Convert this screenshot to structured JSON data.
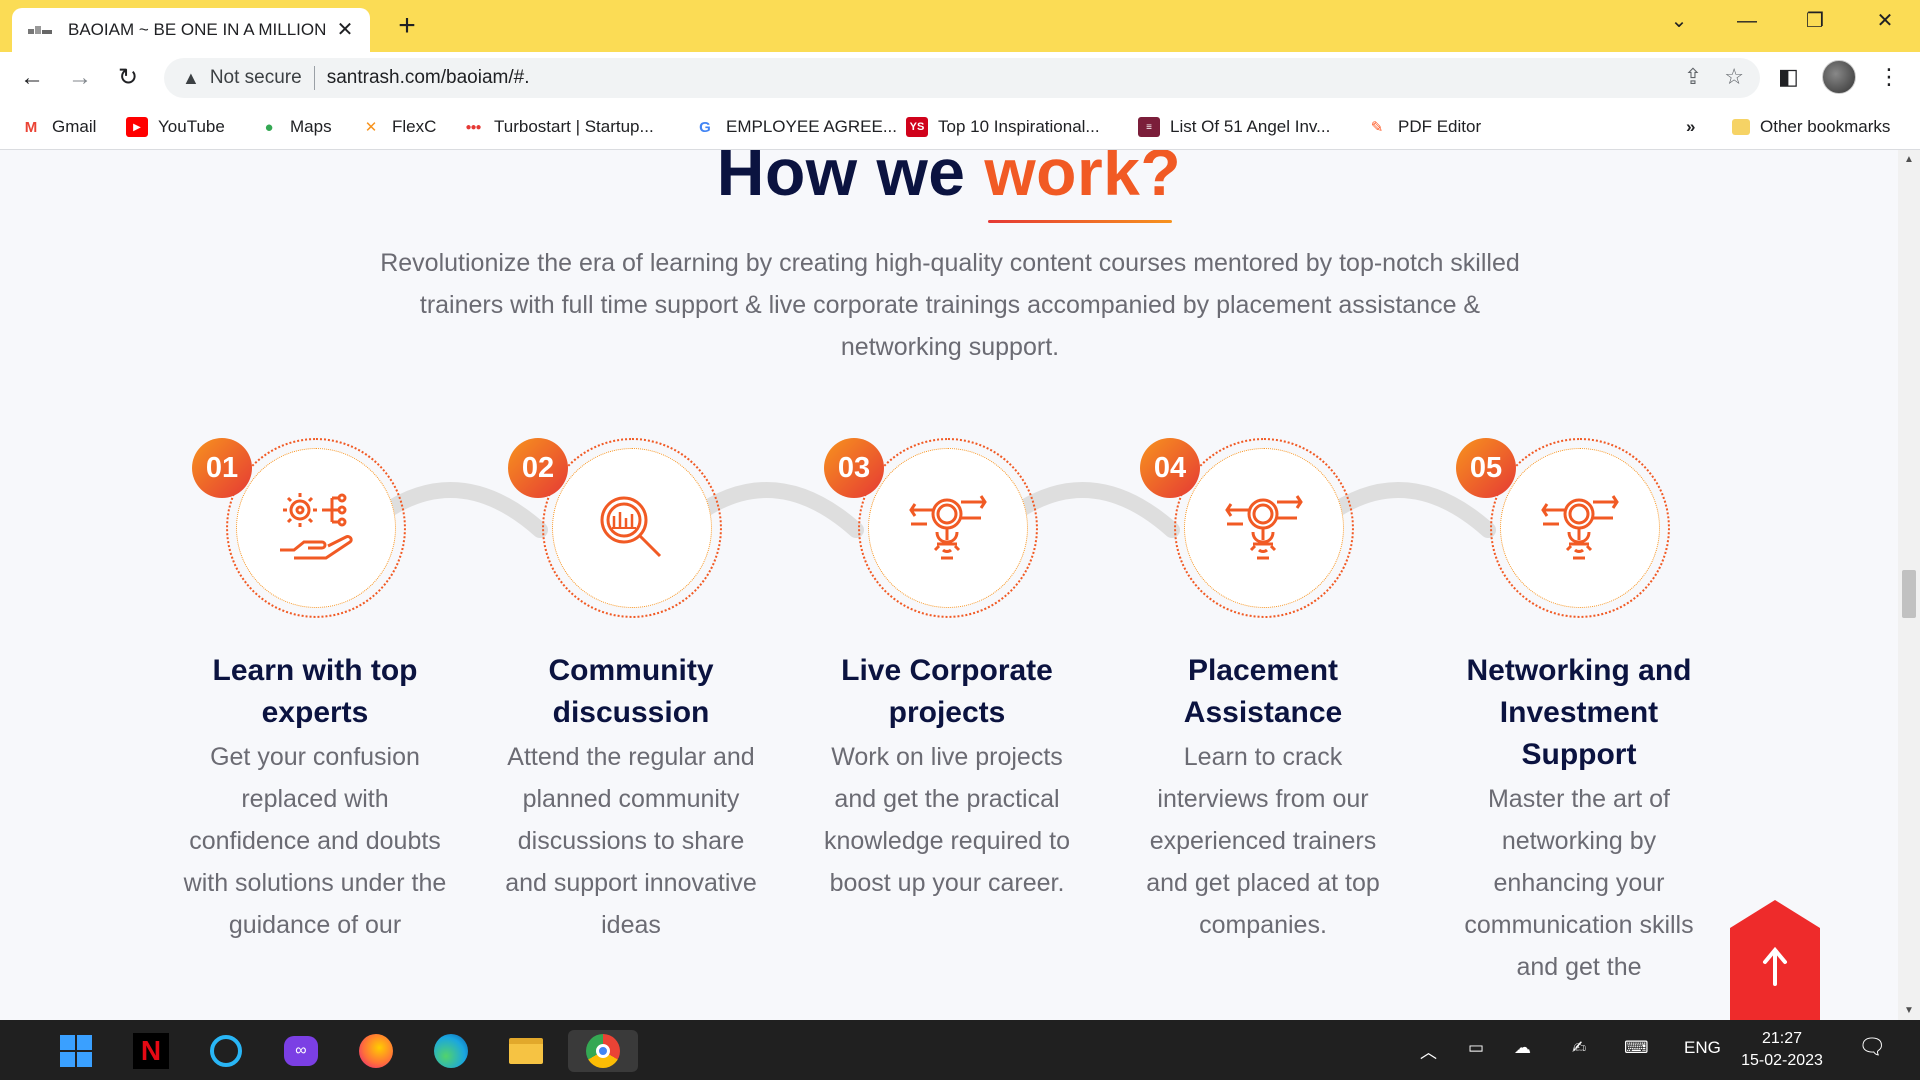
{
  "browser": {
    "tab_title": "BAOIAM ~ BE ONE IN A MILLION",
    "favicon_text": "BAOIAM",
    "security_label": "Not secure",
    "url": "santrash.com/baoiam/#.",
    "bookmarks": [
      {
        "label": "Gmail",
        "icon": "gmail-icon"
      },
      {
        "label": "YouTube",
        "icon": "youtube-icon"
      },
      {
        "label": "Maps",
        "icon": "maps-icon"
      },
      {
        "label": "FlexC",
        "icon": "flexc-icon"
      },
      {
        "label": "Turbostart | Startup...",
        "icon": "turbostart-icon"
      },
      {
        "label": "EMPLOYEE AGREE...",
        "icon": "google-icon"
      },
      {
        "label": "Top 10 Inspirational...",
        "icon": "ys-icon"
      },
      {
        "label": "List Of 51 Angel Inv...",
        "icon": "list-icon"
      },
      {
        "label": "PDF Editor",
        "icon": "pdf-editor-icon"
      }
    ],
    "more_bookmarks": "»",
    "other_bookmarks": "Other bookmarks"
  },
  "page": {
    "heading_main": "How we ",
    "heading_accent": "work?",
    "lead": "Revolutionize the era of learning by creating high-quality content courses mentored by top-notch skilled trainers with full time support & live corporate trainings accompanied by placement assistance & networking support.",
    "steps": [
      {
        "number": "01",
        "icon": "gear-hand-icon",
        "title": "Learn with top experts",
        "description": "Get your confusion replaced with confidence and doubts with solutions under the guidance of our"
      },
      {
        "number": "02",
        "icon": "magnifier-chart-icon",
        "title": "Community discussion",
        "description": "Attend the regular and planned community discussions to share and support innovative ideas"
      },
      {
        "number": "03",
        "icon": "gear-search-icon",
        "title": "Live Corporate projects",
        "description": "Work on live projects and get the practical knowledge required to boost up your career."
      },
      {
        "number": "04",
        "icon": "gear-search-icon",
        "title": "Placement Assistance",
        "description": "Learn to crack interviews from our experienced trainers and get placed at top companies."
      },
      {
        "number": "05",
        "icon": "gear-search-icon",
        "title": "Networking and Investment Support",
        "description": "Master the art of networking by enhancing your communication skills and get the"
      }
    ],
    "scroll_top_icon": "arrow-up-icon"
  },
  "taskbar": {
    "language": "ENG",
    "time": "21:27",
    "date": "15-02-2023"
  },
  "colors": {
    "tab_bar": "#fbdc55",
    "heading": "#0b1340",
    "accent": "#f15a24",
    "scroll_top": "#ee2b2b"
  }
}
